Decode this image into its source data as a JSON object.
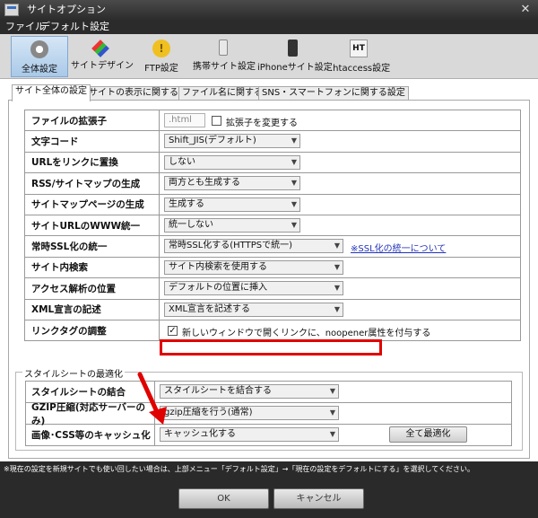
{
  "window": {
    "title": "サイトオプション"
  },
  "menu": {
    "items": [
      "ファイル",
      "デフォルト設定"
    ]
  },
  "toolbar": {
    "items": [
      {
        "label": "全体設定",
        "icon": "gear-icon",
        "active": true
      },
      {
        "label": "サイトデザイン",
        "icon": "palette-icon",
        "active": false
      },
      {
        "label": "FTP設定",
        "icon": "ftp-icon",
        "active": false
      },
      {
        "label": "携帯サイト設定",
        "icon": "mobile-phone-icon",
        "active": false
      },
      {
        "label": "iPhoneサイト設定",
        "icon": "iphone-icon",
        "active": false
      },
      {
        "label": ".htaccess設定",
        "icon": "htaccess-icon",
        "active": false
      }
    ]
  },
  "tabs": [
    {
      "label": "サイト全体の設定",
      "active": true
    },
    {
      "label": "サイトの表示に関する設定",
      "active": false
    },
    {
      "label": "ファイル名に関する設定",
      "active": false
    },
    {
      "label": "SNS・スマートフォンに関する設定",
      "active": false
    }
  ],
  "settings": {
    "file_ext": {
      "label": "ファイルの拡張子",
      "value": ".html",
      "checkbox_label": "拡張子を変更する"
    },
    "charset": {
      "label": "文字コード",
      "value": "Shift_JIS(デフォルト)"
    },
    "url_link": {
      "label": "URLをリンクに置換",
      "value": "しない"
    },
    "rss_sitemap": {
      "label": "RSS/サイトマップの生成",
      "value": "両方とも生成する"
    },
    "sitemap_page": {
      "label": "サイトマップページの生成",
      "value": "生成する"
    },
    "www_unify": {
      "label": "サイトURLのWWW統一",
      "value": "統一しない"
    },
    "ssl_unify": {
      "label": "常時SSL化の統一",
      "value": "常時SSL化する(HTTPSで統一)",
      "link": "※SSL化の統一について"
    },
    "site_search": {
      "label": "サイト内検索",
      "value": "サイト内検索を使用する"
    },
    "analytics_pos": {
      "label": "アクセス解析の位置",
      "value": "デフォルトの位置に挿入"
    },
    "xml_decl": {
      "label": "XML宣言の記述",
      "value": "XML宣言を記述する"
    },
    "link_tag": {
      "label": "リンクタグの調整",
      "checkbox_label": "新しいウィンドウで開くリンクに、noopener属性を付与する",
      "checked": true
    }
  },
  "optimize": {
    "legend": "スタイルシートの最適化",
    "stylesheet": {
      "label": "スタイルシートの結合",
      "value": "スタイルシートを結合する"
    },
    "gzip": {
      "label": "GZIP圧縮(対応サーバーのみ)",
      "value": "gzip圧縮を行う(通常)"
    },
    "cache": {
      "label": "画像･CSS等のキャッシュ化",
      "value": "キャッシュ化する"
    },
    "optimize_all_label": "全て最適化"
  },
  "footer": {
    "note": "※現在の設定を新規サイトでも使い回したい場合は、上部メニュー「デフォルト設定」→「現在の設定をデフォルトにする」を選択してください。",
    "ok_label": "OK",
    "cancel_label": "キャンセル"
  },
  "colors": {
    "highlight": "#e00000",
    "link": "#2233bb",
    "footer_bg": "#2a2a2a"
  }
}
